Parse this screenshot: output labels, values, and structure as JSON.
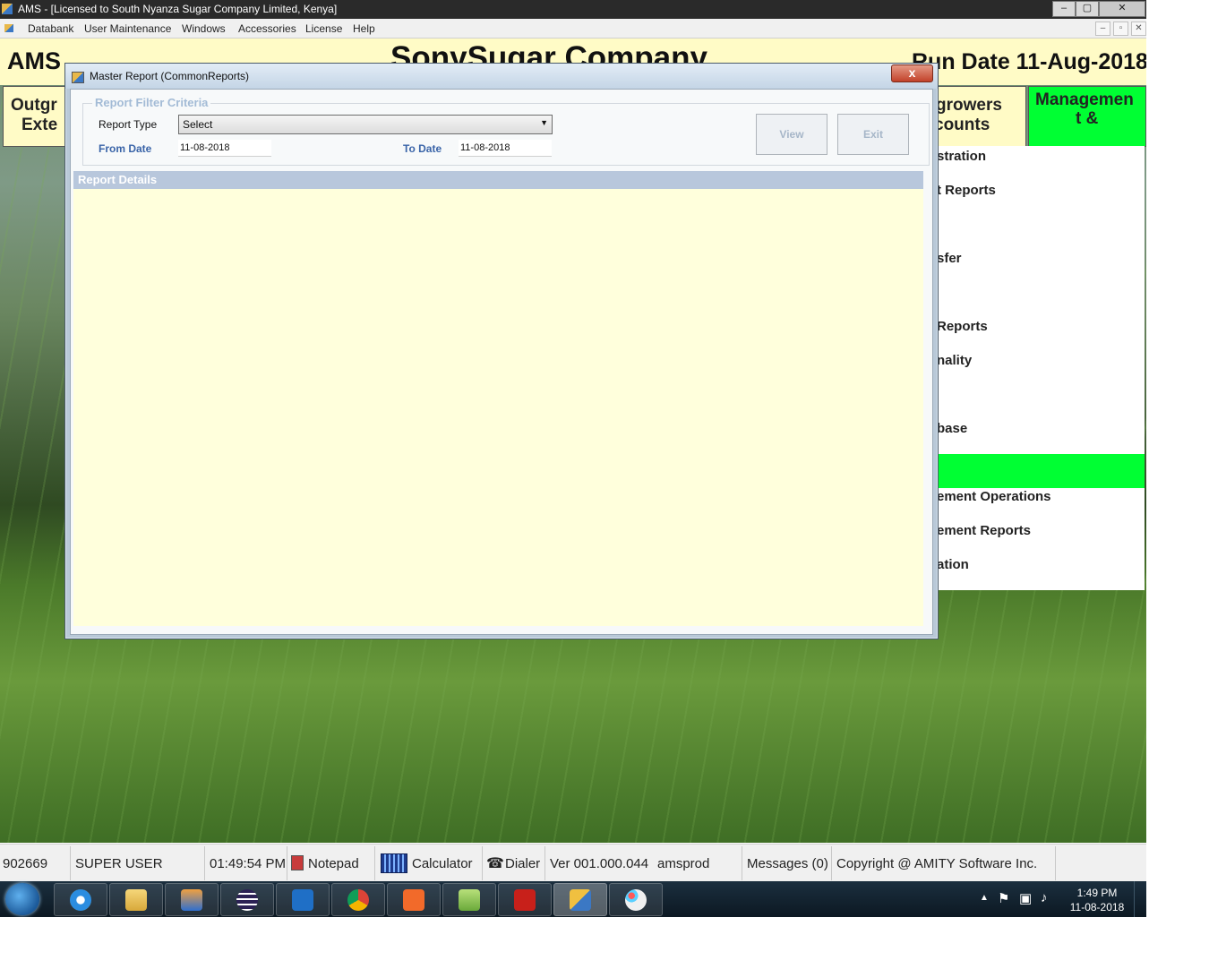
{
  "window": {
    "title": "AMS - [Licensed to South Nyanza Sugar Company Limited, Kenya]",
    "controls": [
      "–",
      "▢",
      "✕"
    ]
  },
  "menu": {
    "items": [
      "Databank",
      "User Maintenance",
      "Windows",
      "Accessories",
      "License",
      "Help"
    ],
    "mdi_controls": [
      "–",
      "▫",
      "✕"
    ]
  },
  "header": {
    "app": "AMS",
    "company": "SonySugar Company",
    "run_date": "Run Date 11-Aug-2018"
  },
  "module_tabs": {
    "left_line1": "Outgr",
    "left_line2": "Exte",
    "right_line1": "growers",
    "right_line2": "counts",
    "active_line1": "Managemen",
    "active_line2": "t &",
    "active_color": "#00ff33"
  },
  "right_panel": {
    "items": [
      "stration",
      "t Reports",
      "sfer",
      "Reports",
      "nality",
      "base",
      "",
      "ement Operations",
      "ement Reports",
      "ation"
    ],
    "highlight_color": "#00ff33"
  },
  "dialog": {
    "title": "Master Report (CommonReports)",
    "close_label": "x",
    "filter_title": "Report Filter Criteria",
    "report_type_label": "Report Type",
    "report_type_value": "Select",
    "from_date_label": "From Date",
    "from_date_value": "11-08-2018",
    "to_date_label": "To Date",
    "to_date_value": "11-08-2018",
    "view_label": "View",
    "exit_label": "Exit",
    "details_title": "Report Details"
  },
  "status_bar": {
    "user_id": "902669",
    "user_name": "SUPER USER",
    "time": "01:49:54 PM",
    "notepad": "Notepad",
    "calculator": "Calculator",
    "dialer": "Dialer",
    "version": "Ver 001.000.044",
    "database": "amsprod",
    "messages": "Messages (0)",
    "copyright": "Copyright @ AMITY Software Inc."
  },
  "taskbar": {
    "apps": [
      "ie-icon",
      "file-explorer-icon",
      "media-player-icon",
      "eclipse-icon",
      "outlook-icon",
      "chrome-icon",
      "xampp-icon",
      "notepad-plus-icon",
      "acrobat-icon",
      "ams-app-icon",
      "paint-icon"
    ],
    "clock_time": "1:49 PM",
    "clock_date": "11-08-2018"
  },
  "colors": {
    "header_bg": "#fffbc6",
    "details_bg": "#ffffdc",
    "label_blue": "#3a64a8"
  }
}
